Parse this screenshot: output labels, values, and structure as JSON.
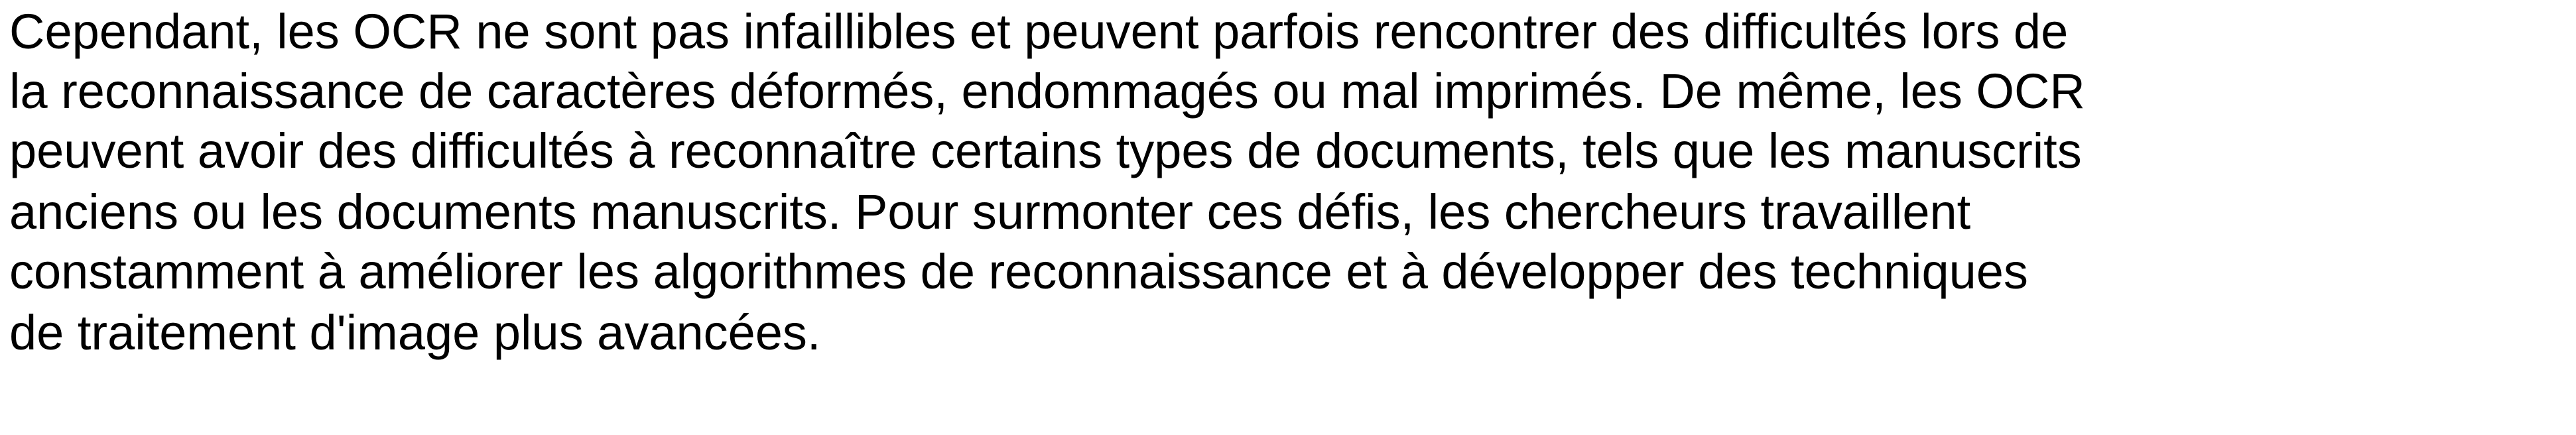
{
  "paragraph": {
    "lines": [
      "Cependant, les OCR ne sont pas infaillibles et peuvent parfois rencontrer des difficultés lors de",
      "la reconnaissance de caractères déformés, endommagés ou mal imprimés. De même, les OCR",
      "peuvent avoir des difficultés à reconnaître certains types de documents, tels que les manuscrits",
      "anciens ou les documents manuscrits. Pour surmonter ces défis, les chercheurs travaillent",
      "constamment à améliorer les algorithmes de reconnaissance et à développer des techniques",
      "de traitement d'image plus avancées."
    ]
  }
}
